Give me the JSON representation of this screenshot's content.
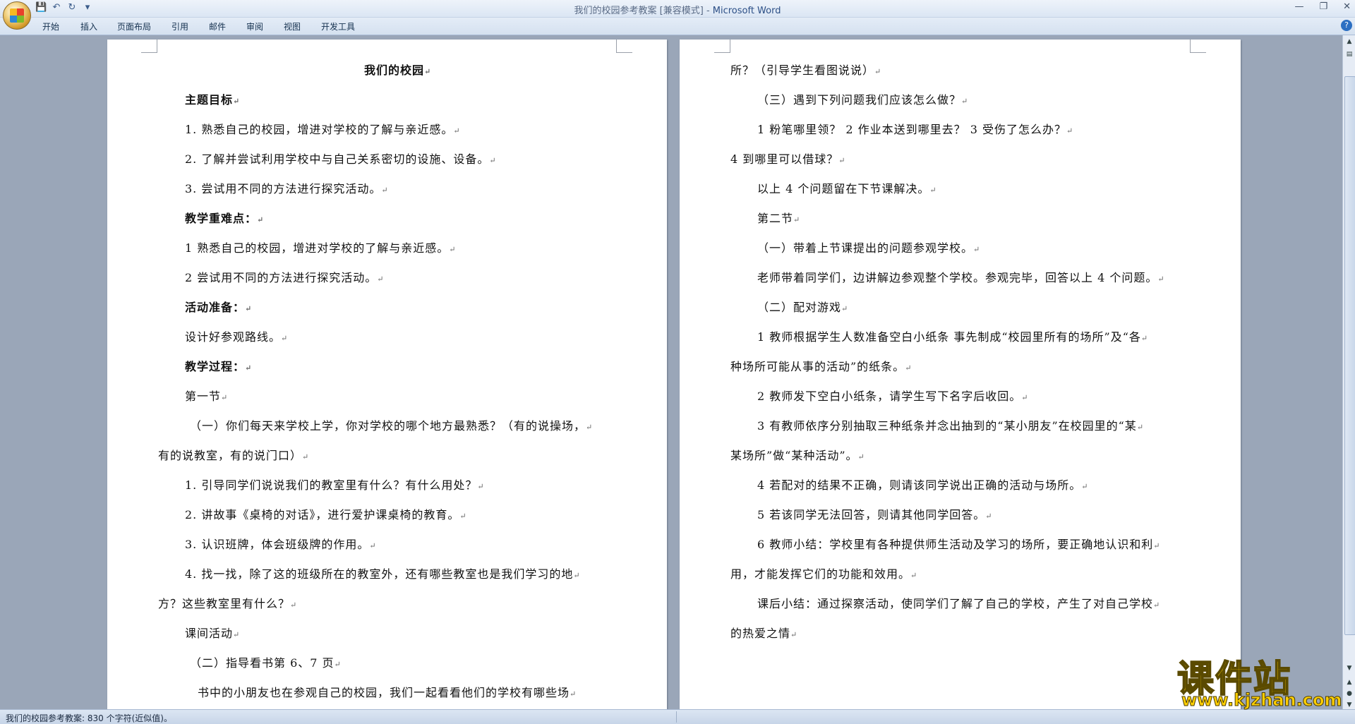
{
  "window": {
    "title": "我们的校园参考教案 [兼容模式]",
    "app_name": "Microsoft Word"
  },
  "ribbon_tabs": [
    "开始",
    "插入",
    "页面布局",
    "引用",
    "邮件",
    "审阅",
    "视图",
    "开发工具"
  ],
  "page1": {
    "title": "我们的校园",
    "lines": [
      "主题目标",
      "1. 熟悉自己的校园，增进对学校的了解与亲近感。",
      "2. 了解并尝试利用学校中与自己关系密切的设施、设备。",
      "3. 尝试用不同的方法进行探究活动。",
      "教学重难点：",
      "1 熟悉自己的校园，增进对学校的了解与亲近感。",
      "2 尝试用不同的方法进行探究活动。",
      "活动准备：",
      "设计好参观路线。",
      "教学过程：",
      "第一节",
      "（一）你们每天来学校上学，你对学校的哪个地方最熟悉？（有的说操场，",
      "有的说教室，有的说门口）",
      "1. 引导同学们说说我们的教室里有什么？有什么用处？",
      "2. 讲故事《桌椅的对话》，进行爱护课桌椅的教育。",
      "3. 认识班牌，体会班级牌的作用。",
      "4. 找一找，除了这的班级所在的教室外，还有哪些教室也是我们学习的地",
      "方？这些教室里有什么？",
      "课间活动",
      "（二）指导看书第 6、7 页",
      "书中的小朋友也在参观自己的校园，我们一起看看他们的学校有哪些场"
    ]
  },
  "page2": {
    "lines": [
      "所？（引导学生看图说说）",
      "（三）遇到下列问题我们应该怎么做？",
      "1 粉笔哪里领？        2 作业本送到哪里去？             3 受伤了怎么办？",
      "4 到哪里可以借球？",
      "以上 4 个问题留在下节课解决。",
      "第二节",
      "（一）带着上节课提出的问题参观学校。",
      "老师带着同学们，边讲解边参观整个学校。参观完毕，回答以上 4 个问题。",
      "（二）配对游戏",
      "1 教师根据学生人数准备空白小纸条 事先制成“校园里所有的场所”及“各",
      "种场所可能从事的活动”的纸条。",
      "2 教师发下空白小纸条，请学生写下名字后收回。",
      "3 有教师依序分别抽取三种纸条并念出抽到的“某小朋友”在校园里的“某",
      "某场所”做“某种活动”。",
      "4 若配对的结果不正确，则请该同学说出正确的活动与场所。",
      "5 若该同学无法回答，则请其他同学回答。",
      "6 教师小结：学校里有各种提供师生活动及学习的场所，要正确地认识和利",
      "用，才能发挥它们的功能和效用。",
      "课后小结：通过探察活动，使同学们了解了自己的学校，产生了对自己学校",
      "的热爱之情"
    ]
  },
  "status_bar": {
    "text": "我们的校园参考教案: 830 个字符(近似值)。"
  },
  "watermark": {
    "title": "课件站",
    "url": "www.kjzhan.com"
  }
}
